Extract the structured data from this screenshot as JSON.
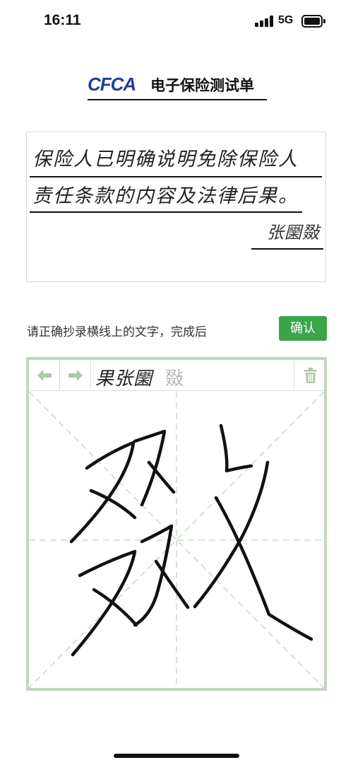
{
  "status_bar": {
    "time": "16:11",
    "network": "5G",
    "icons": [
      "signal-icon",
      "battery-icon"
    ]
  },
  "header": {
    "logo": "CFCA",
    "title": "电子保险测试单",
    "brand_color": "#1d3f9a"
  },
  "reference": {
    "line1": "保险人已明确说明免除保险人",
    "line2": "责任条款的内容及法律后果。",
    "signature": "张圞敠"
  },
  "instruction": {
    "text": "请正确抄录横线上的文字，完成后",
    "confirm_label": "确认",
    "confirm_color": "#3aa54b"
  },
  "writing_pad": {
    "written_text": "果张圞",
    "pending_char": "敠",
    "icons": [
      "arrow-left-icon",
      "arrow-right-icon",
      "trash-icon"
    ],
    "border_color": "#c2d6bf"
  }
}
